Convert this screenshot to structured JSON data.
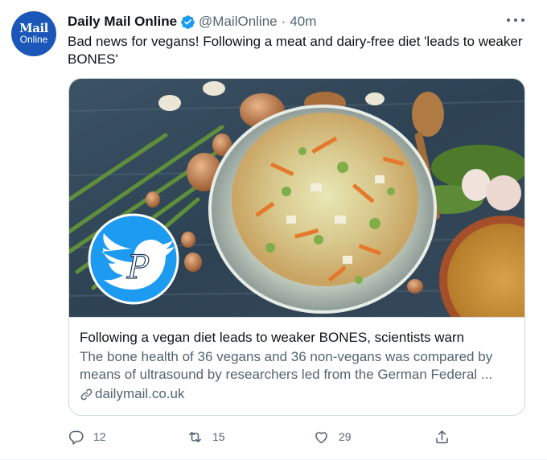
{
  "account": {
    "avatar_line1": "Mail",
    "avatar_line2": "Online",
    "name": "Daily Mail Online",
    "handle": "@MailOnline",
    "separator": "·",
    "time": "40m"
  },
  "tweet": {
    "text": "Bad news for vegans! Following a meat and dairy-free diet 'leads to weaker BONES'"
  },
  "card": {
    "image_description": "Glass bowl of shredded vegetable salad surrounded by onions, garlic, greens and wooden spoons, with a blue bird logo overlay",
    "title": "Following a vegan diet leads to weaker BONES, scientists warn",
    "description": "The bone health of 36 vegans and 36 non-vegans was compared by means of ultrasound by researchers led from the German Federal ...",
    "domain": "dailymail.co.uk"
  },
  "actions": {
    "reply_count": "12",
    "retweet_count": "15",
    "like_count": "29"
  },
  "colors": {
    "verified": "#1d9bf0",
    "avatar": "#1a57b8",
    "secondary_text": "#536471",
    "border": "#cfd9de"
  }
}
